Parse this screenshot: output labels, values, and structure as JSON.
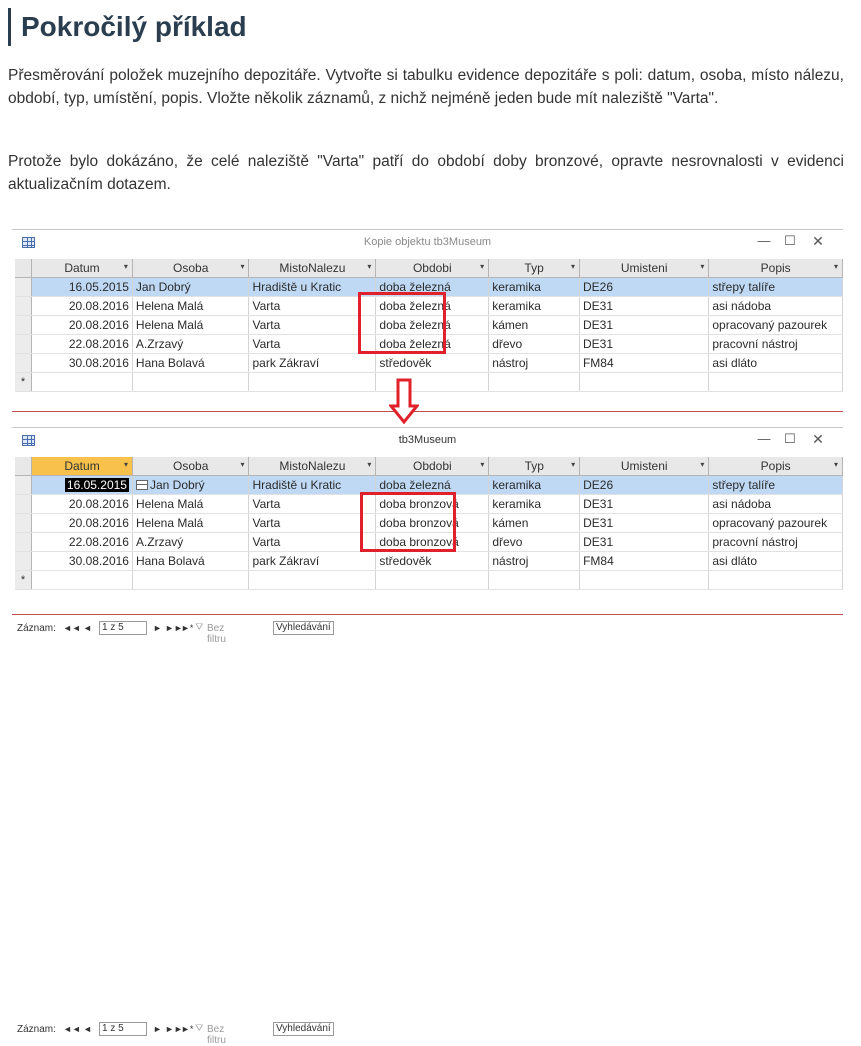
{
  "title": "Pokročilý příklad",
  "paragraphs": [
    "Přesměrování položek muzejního depozitáře. Vytvořte si tabulku evidence depozitáře s poli: datum, osoba, místo nálezu, období, typ, umístění, popis. Vložte několik záznamů, z nichž nejméně jeden bude mít naleziště \"Varta\".",
    "Protože bylo dokázáno, že celé naleziště \"Varta\" patří do období doby bronzové, opravte nesrovnalosti v evidenci aktualizačním dotazem."
  ],
  "columns": [
    "Datum",
    "Osoba",
    "MistoNalezu",
    "Obdobi",
    "Typ",
    "Umisteni",
    "Popis"
  ],
  "window_before": {
    "title": "Kopie objektu tb3Museum",
    "rows": [
      [
        "16.05.2015",
        "Jan Dobrý",
        "Hradiště u Kratic",
        "doba železná",
        "keramika",
        "DE26",
        "střepy talíře"
      ],
      [
        "20.08.2016",
        "Helena Malá",
        "Varta",
        "doba železná",
        "keramika",
        "DE31",
        "asi nádoba"
      ],
      [
        "20.08.2016",
        "Helena Malá",
        "Varta",
        "doba železná",
        "kámen",
        "DE31",
        "opracovaný pazourek"
      ],
      [
        "22.08.2016",
        "A.Zrzavý",
        "Varta",
        "doba železná",
        "dřevo",
        "DE31",
        "pracovní nástroj"
      ],
      [
        "30.08.2016",
        "Hana Bolavá",
        "park Zákraví",
        "středověk",
        "nástroj",
        "FM84",
        "asi dláto"
      ]
    ]
  },
  "window_after": {
    "title": "tb3Museum",
    "rows": [
      [
        "16.05.2015",
        "Jan Dobrý",
        "Hradiště u Kratic",
        "doba železná",
        "keramika",
        "DE26",
        "střepy talíře"
      ],
      [
        "20.08.2016",
        "Helena Malá",
        "Varta",
        "doba bronzová",
        "keramika",
        "DE31",
        "asi nádoba"
      ],
      [
        "20.08.2016",
        "Helena Malá",
        "Varta",
        "doba bronzová",
        "kámen",
        "DE31",
        "opracovaný pazourek"
      ],
      [
        "22.08.2016",
        "A.Zrzavý",
        "Varta",
        "doba bronzová",
        "dřevo",
        "DE31",
        "pracovní nástroj"
      ],
      [
        "30.08.2016",
        "Hana Bolavá",
        "park Zákraví",
        "středověk",
        "nástroj",
        "FM84",
        "asi dláto"
      ]
    ]
  },
  "new_row_marker": "*",
  "navigation": {
    "label": "Záznam:",
    "first": "◄◄",
    "prev": "◄",
    "position": "1 z 5",
    "next": "►",
    "last": "►►",
    "new": "►*",
    "filter": "Bez filtru",
    "search": "Vyhledávání"
  },
  "window_controls": {
    "minimize": "—",
    "maximize": "☐",
    "close": "✕"
  },
  "colors": {
    "highlight": "#e0202a",
    "current_row": "#bfd9f4",
    "active_header": "#f7c14b",
    "heading": "#2a3e50"
  }
}
